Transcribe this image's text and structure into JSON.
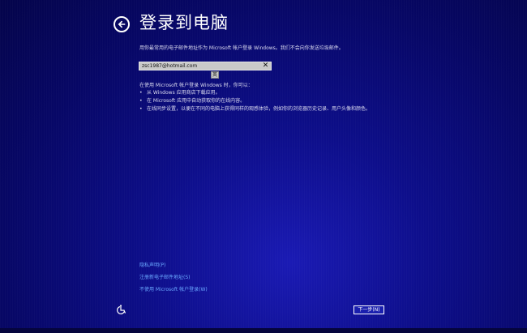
{
  "title": "登录到电脑",
  "instruction": "用你最常用的电子邮件地址作为 Microsoft 帐户登录 Windows。我们不会向你发送垃圾邮件。",
  "email": {
    "value": "zsc1987@hotmail.com",
    "clear_label": "✕",
    "ime_candidate": "英"
  },
  "benefits": {
    "heading": "在使用 Microsoft 帐户登录 Windows 时，你可以：",
    "bullet": "•",
    "items": [
      "从 Windows 应用商店下载应用。",
      "在 Microsoft 应用中自动获取你的在线内容。",
      "在线同步设置，以便在不同的电脑上获得同样的观感体验，例如你的浏览器历史记录、用户头像和颜色。"
    ]
  },
  "links": {
    "privacy": "隐私声明(P)",
    "register": "注册新电子邮件地址(S)",
    "local_account": "不使用 Microsoft 帐户登录(W)"
  },
  "next_button": "下一步(N)",
  "icons": {
    "back": "back-arrow-icon",
    "ease_of_access": "ease-of-access-icon"
  },
  "colors": {
    "background": "#0d0e8a",
    "link": "#6aa8ff",
    "input_bg": "#c9c9c9"
  }
}
